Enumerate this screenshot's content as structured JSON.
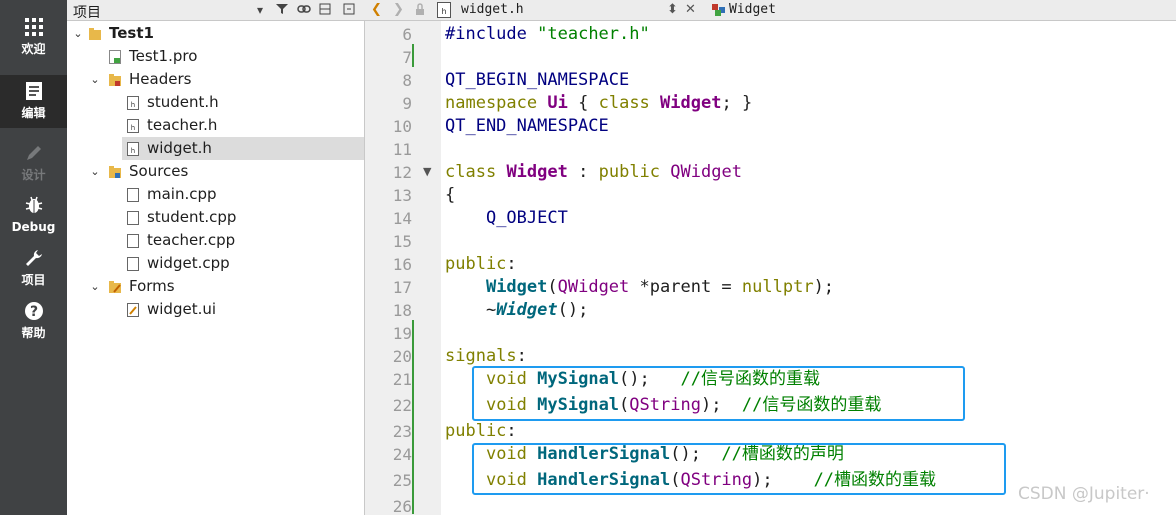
{
  "modebar": {
    "items": [
      {
        "label": "欢迎",
        "icon": "grid-icon"
      },
      {
        "label": "编辑",
        "icon": "edit-document-icon"
      },
      {
        "label": "设计",
        "icon": "pencil-icon"
      },
      {
        "label": "Debug",
        "icon": "bug-icon"
      },
      {
        "label": "项目",
        "icon": "wrench-icon"
      },
      {
        "label": "帮助",
        "icon": "help-icon"
      }
    ]
  },
  "project_pane": {
    "title": "项目",
    "tree": [
      {
        "label": "Test1"
      },
      {
        "label": "Test1.pro"
      },
      {
        "label": "Headers"
      },
      {
        "label": "student.h"
      },
      {
        "label": "teacher.h"
      },
      {
        "label": "widget.h"
      },
      {
        "label": "Sources"
      },
      {
        "label": "main.cpp"
      },
      {
        "label": "student.cpp"
      },
      {
        "label": "teacher.cpp"
      },
      {
        "label": "widget.cpp"
      },
      {
        "label": "Forms"
      },
      {
        "label": "widget.ui"
      }
    ]
  },
  "editor": {
    "file_name": "widget.h",
    "symbol": "Widget",
    "line_numbers": [
      "6",
      "7",
      "8",
      "9",
      "10",
      "11",
      "12",
      "13",
      "14",
      "15",
      "16",
      "17",
      "18",
      "19",
      "20",
      "21",
      "22",
      "23",
      "24",
      "25",
      "26"
    ],
    "code": {
      "l6_inc": "#include",
      "l6_str": "\"teacher.h\"",
      "l8": "QT_BEGIN_NAMESPACE",
      "l9_ns": "namespace",
      "l9_ui": "Ui",
      "l9_brace_open": "{",
      "l9_class": "class",
      "l9_widget": "Widget",
      "l9_end": "; }",
      "l10": "QT_END_NAMESPACE",
      "l12_class": "class",
      "l12_widget": "Widget",
      "l12_colon": ":",
      "l12_public": "public",
      "l12_qwidget": "QWidget",
      "l13": "{",
      "l14": "Q_OBJECT",
      "l16_public": "public",
      "l16_colon": ":",
      "l17_widget": "Widget",
      "l17_paren": "(",
      "l17_qwidget": "QWidget",
      "l17_mid": "*parent =",
      "l17_null": "nullptr",
      "l17_end": ");",
      "l18_tilde": "~",
      "l18_widget": "Widget",
      "l18_end": "();",
      "l20_signals": "signals",
      "l20_colon": ":",
      "l21_void": "void",
      "l21_fn": "MySignal",
      "l21_end": "();",
      "l21_cm": "//信号函数的重载",
      "l22_void": "void",
      "l22_fn": "MySignal",
      "l22_open": "(",
      "l22_type": "QString",
      "l22_end": ");",
      "l22_cm": "//信号函数的重载",
      "l23_public": "public",
      "l23_colon": ":",
      "l24_void": "void",
      "l24_fn": "HandlerSignal",
      "l24_end": "();",
      "l24_cm": "//槽函数的声明",
      "l25_void": "void",
      "l25_fn": "HandlerSignal",
      "l25_open": "(",
      "l25_type": "QString",
      "l25_end": ");",
      "l25_cm": "//槽函数的重载"
    }
  },
  "watermark": "CSDN @Jupiter·",
  "colors": {
    "highlight_box": "#1e9bf0",
    "keyword": "#808000",
    "type": "#800080",
    "function": "#00677c",
    "comment": "#008000"
  }
}
